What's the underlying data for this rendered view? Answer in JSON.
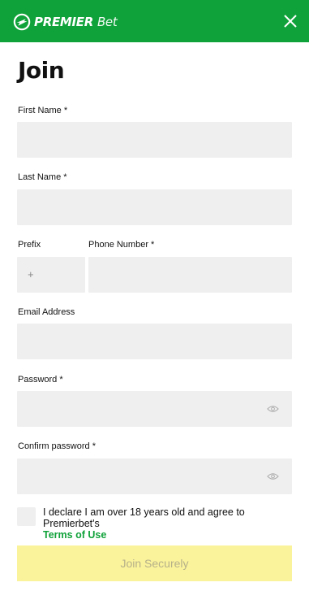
{
  "header": {
    "logo_main": "PREMIER",
    "logo_sub": "Bet",
    "brand_color": "#10a23a",
    "close_icon": "close-icon"
  },
  "page": {
    "title": "Join"
  },
  "form": {
    "first_name_label": "First Name *",
    "last_name_label": "Last Name *",
    "prefix_label": "Prefix",
    "prefix_value": "+",
    "phone_label": "Phone Number *",
    "email_label": "Email Address",
    "password_label": "Password *",
    "confirm_password_label": "Confirm password *",
    "password_visibility_icon": "eye-icon"
  },
  "consent": {
    "text": "I declare I am over 18 years old and agree to Premierbet's",
    "terms_link": "Terms of Use"
  },
  "actions": {
    "join_label": "Join Securely",
    "join_bg": "#fbf39b"
  }
}
